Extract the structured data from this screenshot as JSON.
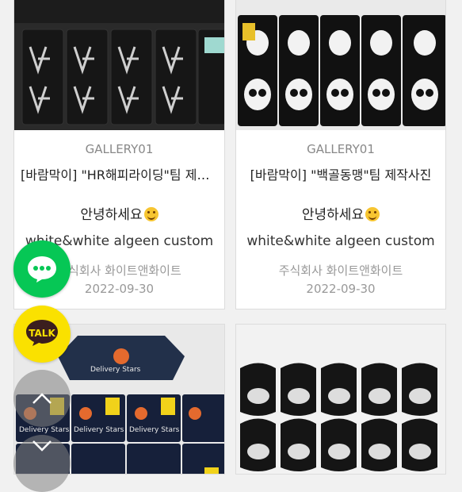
{
  "cards": [
    {
      "gallery": "GALLERY01",
      "title": "[바람막이] \"HR해피라이딩\"팀 제작사진",
      "greeting": "안녕하세요",
      "snippet": "white&white algeen custom",
      "company": "주식회사 화이트앤화이트",
      "date": "2022-09-30"
    },
    {
      "gallery": "GALLERY01",
      "title": "[바람막이] \"백골동맹\"팀 제작사진",
      "greeting": "안녕하세요",
      "snippet": "white&white algeen custom",
      "company": "주식회사 화이트앤화이트",
      "date": "2022-09-30"
    }
  ],
  "photo_text": {
    "delivery_1": "Delivery Stars",
    "delivery_2": "Delivery Stars",
    "delivery_3": "Delivery Stars",
    "delivery_4": "Delivery Stars"
  },
  "floating": {
    "kakao_label": "TALK"
  },
  "colors": {
    "line_green": "#06c755",
    "kakao_yellow": "#fae100"
  }
}
